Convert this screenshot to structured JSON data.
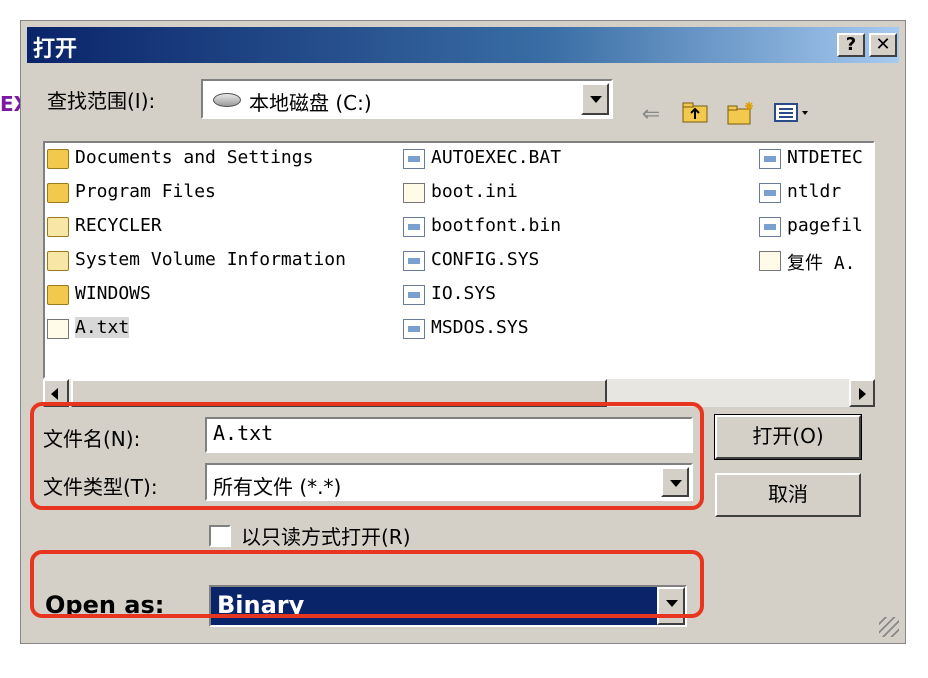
{
  "background": {
    "edge_glyph": "EX"
  },
  "dialog": {
    "title": "打开",
    "help_button": "?",
    "close_button": "✕",
    "look_in": {
      "label": "查找范围(I):",
      "value": "本地磁盘 (C:)"
    },
    "toolbar_icons": [
      "back-arrow-icon",
      "up-folder-icon",
      "new-folder-icon",
      "view-menu-icon"
    ],
    "files": [
      {
        "name": "Documents and Settings",
        "icon": "folder-icon"
      },
      {
        "name": "Program Files",
        "icon": "folder-icon"
      },
      {
        "name": "RECYCLER",
        "icon": "system-folder-icon"
      },
      {
        "name": "System Volume Information",
        "icon": "system-folder-icon"
      },
      {
        "name": "WINDOWS",
        "icon": "folder-icon"
      },
      {
        "name": "A.txt",
        "icon": "text-file-icon"
      },
      {
        "name": "AUTOEXEC.BAT",
        "icon": "batch-file-icon"
      },
      {
        "name": "boot.ini",
        "icon": "config-file-icon"
      },
      {
        "name": "bootfont.bin",
        "icon": "system-file-icon"
      },
      {
        "name": "CONFIG.SYS",
        "icon": "system-file-icon"
      },
      {
        "name": "IO.SYS",
        "icon": "system-file-icon"
      },
      {
        "name": "MSDOS.SYS",
        "icon": "system-file-icon"
      },
      {
        "name": "NTDETEC",
        "icon": "system-file-icon"
      },
      {
        "name": "ntldr",
        "icon": "system-file-icon"
      },
      {
        "name": "pagefil",
        "icon": "system-file-icon"
      },
      {
        "name": "复件 A.",
        "icon": "text-file-icon"
      }
    ],
    "filename": {
      "label": "文件名(N):",
      "value": "A.txt"
    },
    "filetype": {
      "label": "文件类型(T):",
      "value": "所有文件 (*.*)"
    },
    "open_button": "打开(O)",
    "cancel_button": "取消",
    "readonly_checkbox": {
      "label": "以只读方式打开(R)",
      "checked": false
    },
    "open_as": {
      "label": "Open as:",
      "value": "Binary"
    }
  },
  "colors": {
    "highlight": "#e8351f",
    "titlebar": "#0a246a",
    "dialog_bg": "#d4d0c8"
  }
}
